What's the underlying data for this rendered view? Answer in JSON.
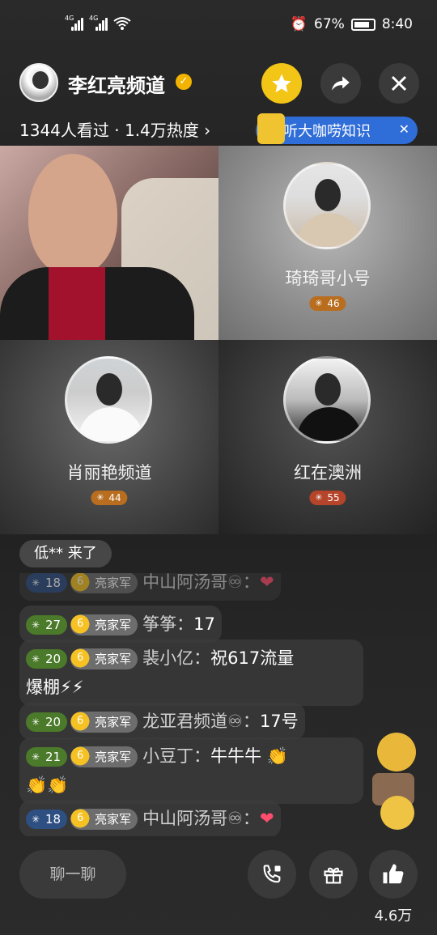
{
  "status_bar": {
    "net1": "4G",
    "net2": "4G",
    "battery": "67%",
    "time": "8:40"
  },
  "header": {
    "channel_name": "李红亮频道",
    "viewers_text": "1344人看过 · 1.4万热度 ›"
  },
  "banner": {
    "text": "听大咖唠知识",
    "close": "✕"
  },
  "guests": [
    {
      "name": "琦琦哥小号",
      "level": "46"
    },
    {
      "name": "肖丽艳频道",
      "level": "44"
    },
    {
      "name": "红在澳洲",
      "level": "55"
    }
  ],
  "join_notice": "低** 来了",
  "comments": [
    {
      "level": "18",
      "fan": "亮家军",
      "user": "中山阿汤哥♾：",
      "text": "",
      "heart": "❤"
    },
    {
      "level": "27",
      "fan": "亮家军",
      "user": "筝筝：",
      "text": "17"
    },
    {
      "level": "20",
      "fan": "亮家军",
      "user": "裴小亿：",
      "text": "祝617流量",
      "text2": "爆棚⚡⚡"
    },
    {
      "level": "20",
      "fan": "亮家军",
      "user": "龙亚君频道♾：",
      "text": "17号"
    },
    {
      "level": "21",
      "fan": "亮家军",
      "user": "小豆丁：",
      "text": "牛牛牛 👏",
      "text2": "👏👏"
    },
    {
      "level": "18",
      "fan": "亮家军",
      "user": "中山阿汤哥♾：",
      "text": "",
      "heart": "❤"
    }
  ],
  "bottom": {
    "chat_placeholder": "聊一聊",
    "like_count": "4.6万"
  },
  "colors": {
    "accent_yellow": "#f3c516",
    "banner_blue": "#2f6dd8",
    "level_green": "#4b7a2a",
    "level_blue": "#2e4f82"
  }
}
